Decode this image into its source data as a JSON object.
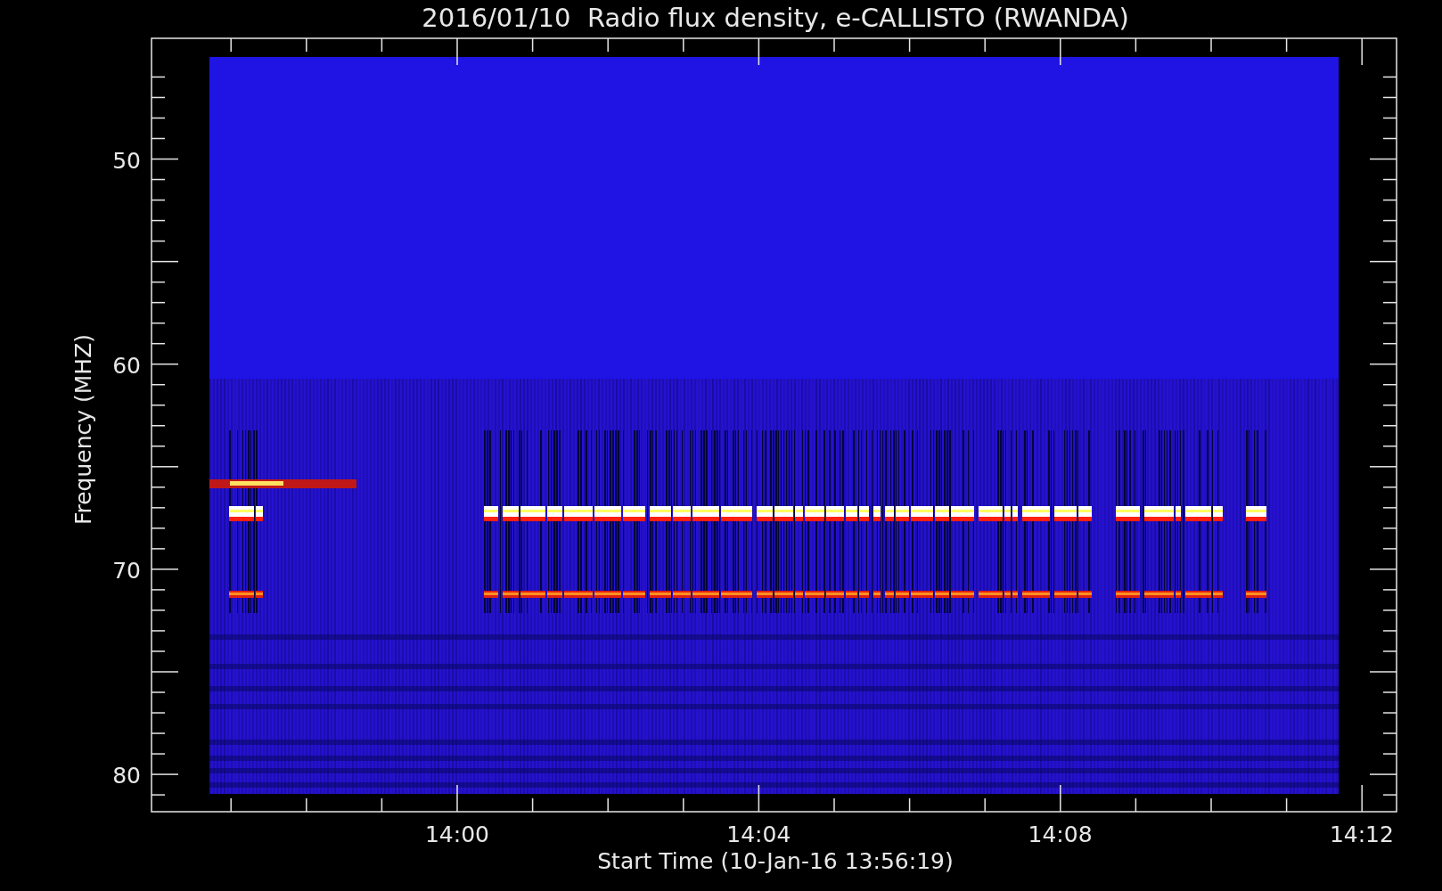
{
  "title": "2016/01/10  Radio flux density, e-CALLISTO (RWANDA)",
  "y_axis": {
    "label": "Frequency (MHZ)",
    "ticks": [
      "50",
      "60",
      "70",
      "80"
    ]
  },
  "x_axis": {
    "label": "Start Time (10-Jan-16 13:56:19)",
    "ticks": [
      "14:00",
      "14:04",
      "14:08",
      "14:12"
    ]
  }
}
